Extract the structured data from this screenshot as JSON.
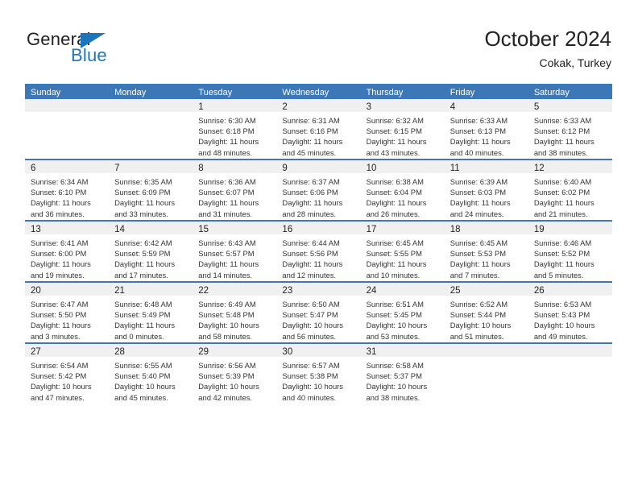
{
  "logo": {
    "word_one": "General",
    "word_two": "Blue",
    "accent_color": "#1b75bb"
  },
  "header": {
    "title": "October 2024",
    "subtitle": "Cokak, Turkey"
  },
  "theme": {
    "header_blue": "#3c77b8",
    "daynum_band": "#f0f0f0",
    "text": "#333333"
  },
  "weekdays": [
    "Sunday",
    "Monday",
    "Tuesday",
    "Wednesday",
    "Thursday",
    "Friday",
    "Saturday"
  ],
  "weeks": [
    [
      {
        "day": "",
        "sunrise": "",
        "sunset": "",
        "daylight_line1": "",
        "daylight_line2": ""
      },
      {
        "day": "",
        "sunrise": "",
        "sunset": "",
        "daylight_line1": "",
        "daylight_line2": ""
      },
      {
        "day": "1",
        "sunrise": "Sunrise: 6:30 AM",
        "sunset": "Sunset: 6:18 PM",
        "daylight_line1": "Daylight: 11 hours",
        "daylight_line2": "and 48 minutes."
      },
      {
        "day": "2",
        "sunrise": "Sunrise: 6:31 AM",
        "sunset": "Sunset: 6:16 PM",
        "daylight_line1": "Daylight: 11 hours",
        "daylight_line2": "and 45 minutes."
      },
      {
        "day": "3",
        "sunrise": "Sunrise: 6:32 AM",
        "sunset": "Sunset: 6:15 PM",
        "daylight_line1": "Daylight: 11 hours",
        "daylight_line2": "and 43 minutes."
      },
      {
        "day": "4",
        "sunrise": "Sunrise: 6:33 AM",
        "sunset": "Sunset: 6:13 PM",
        "daylight_line1": "Daylight: 11 hours",
        "daylight_line2": "and 40 minutes."
      },
      {
        "day": "5",
        "sunrise": "Sunrise: 6:33 AM",
        "sunset": "Sunset: 6:12 PM",
        "daylight_line1": "Daylight: 11 hours",
        "daylight_line2": "and 38 minutes."
      }
    ],
    [
      {
        "day": "6",
        "sunrise": "Sunrise: 6:34 AM",
        "sunset": "Sunset: 6:10 PM",
        "daylight_line1": "Daylight: 11 hours",
        "daylight_line2": "and 36 minutes."
      },
      {
        "day": "7",
        "sunrise": "Sunrise: 6:35 AM",
        "sunset": "Sunset: 6:09 PM",
        "daylight_line1": "Daylight: 11 hours",
        "daylight_line2": "and 33 minutes."
      },
      {
        "day": "8",
        "sunrise": "Sunrise: 6:36 AM",
        "sunset": "Sunset: 6:07 PM",
        "daylight_line1": "Daylight: 11 hours",
        "daylight_line2": "and 31 minutes."
      },
      {
        "day": "9",
        "sunrise": "Sunrise: 6:37 AM",
        "sunset": "Sunset: 6:06 PM",
        "daylight_line1": "Daylight: 11 hours",
        "daylight_line2": "and 28 minutes."
      },
      {
        "day": "10",
        "sunrise": "Sunrise: 6:38 AM",
        "sunset": "Sunset: 6:04 PM",
        "daylight_line1": "Daylight: 11 hours",
        "daylight_line2": "and 26 minutes."
      },
      {
        "day": "11",
        "sunrise": "Sunrise: 6:39 AM",
        "sunset": "Sunset: 6:03 PM",
        "daylight_line1": "Daylight: 11 hours",
        "daylight_line2": "and 24 minutes."
      },
      {
        "day": "12",
        "sunrise": "Sunrise: 6:40 AM",
        "sunset": "Sunset: 6:02 PM",
        "daylight_line1": "Daylight: 11 hours",
        "daylight_line2": "and 21 minutes."
      }
    ],
    [
      {
        "day": "13",
        "sunrise": "Sunrise: 6:41 AM",
        "sunset": "Sunset: 6:00 PM",
        "daylight_line1": "Daylight: 11 hours",
        "daylight_line2": "and 19 minutes."
      },
      {
        "day": "14",
        "sunrise": "Sunrise: 6:42 AM",
        "sunset": "Sunset: 5:59 PM",
        "daylight_line1": "Daylight: 11 hours",
        "daylight_line2": "and 17 minutes."
      },
      {
        "day": "15",
        "sunrise": "Sunrise: 6:43 AM",
        "sunset": "Sunset: 5:57 PM",
        "daylight_line1": "Daylight: 11 hours",
        "daylight_line2": "and 14 minutes."
      },
      {
        "day": "16",
        "sunrise": "Sunrise: 6:44 AM",
        "sunset": "Sunset: 5:56 PM",
        "daylight_line1": "Daylight: 11 hours",
        "daylight_line2": "and 12 minutes."
      },
      {
        "day": "17",
        "sunrise": "Sunrise: 6:45 AM",
        "sunset": "Sunset: 5:55 PM",
        "daylight_line1": "Daylight: 11 hours",
        "daylight_line2": "and 10 minutes."
      },
      {
        "day": "18",
        "sunrise": "Sunrise: 6:45 AM",
        "sunset": "Sunset: 5:53 PM",
        "daylight_line1": "Daylight: 11 hours",
        "daylight_line2": "and 7 minutes."
      },
      {
        "day": "19",
        "sunrise": "Sunrise: 6:46 AM",
        "sunset": "Sunset: 5:52 PM",
        "daylight_line1": "Daylight: 11 hours",
        "daylight_line2": "and 5 minutes."
      }
    ],
    [
      {
        "day": "20",
        "sunrise": "Sunrise: 6:47 AM",
        "sunset": "Sunset: 5:50 PM",
        "daylight_line1": "Daylight: 11 hours",
        "daylight_line2": "and 3 minutes."
      },
      {
        "day": "21",
        "sunrise": "Sunrise: 6:48 AM",
        "sunset": "Sunset: 5:49 PM",
        "daylight_line1": "Daylight: 11 hours",
        "daylight_line2": "and 0 minutes."
      },
      {
        "day": "22",
        "sunrise": "Sunrise: 6:49 AM",
        "sunset": "Sunset: 5:48 PM",
        "daylight_line1": "Daylight: 10 hours",
        "daylight_line2": "and 58 minutes."
      },
      {
        "day": "23",
        "sunrise": "Sunrise: 6:50 AM",
        "sunset": "Sunset: 5:47 PM",
        "daylight_line1": "Daylight: 10 hours",
        "daylight_line2": "and 56 minutes."
      },
      {
        "day": "24",
        "sunrise": "Sunrise: 6:51 AM",
        "sunset": "Sunset: 5:45 PM",
        "daylight_line1": "Daylight: 10 hours",
        "daylight_line2": "and 53 minutes."
      },
      {
        "day": "25",
        "sunrise": "Sunrise: 6:52 AM",
        "sunset": "Sunset: 5:44 PM",
        "daylight_line1": "Daylight: 10 hours",
        "daylight_line2": "and 51 minutes."
      },
      {
        "day": "26",
        "sunrise": "Sunrise: 6:53 AM",
        "sunset": "Sunset: 5:43 PM",
        "daylight_line1": "Daylight: 10 hours",
        "daylight_line2": "and 49 minutes."
      }
    ],
    [
      {
        "day": "27",
        "sunrise": "Sunrise: 6:54 AM",
        "sunset": "Sunset: 5:42 PM",
        "daylight_line1": "Daylight: 10 hours",
        "daylight_line2": "and 47 minutes."
      },
      {
        "day": "28",
        "sunrise": "Sunrise: 6:55 AM",
        "sunset": "Sunset: 5:40 PM",
        "daylight_line1": "Daylight: 10 hours",
        "daylight_line2": "and 45 minutes."
      },
      {
        "day": "29",
        "sunrise": "Sunrise: 6:56 AM",
        "sunset": "Sunset: 5:39 PM",
        "daylight_line1": "Daylight: 10 hours",
        "daylight_line2": "and 42 minutes."
      },
      {
        "day": "30",
        "sunrise": "Sunrise: 6:57 AM",
        "sunset": "Sunset: 5:38 PM",
        "daylight_line1": "Daylight: 10 hours",
        "daylight_line2": "and 40 minutes."
      },
      {
        "day": "31",
        "sunrise": "Sunrise: 6:58 AM",
        "sunset": "Sunset: 5:37 PM",
        "daylight_line1": "Daylight: 10 hours",
        "daylight_line2": "and 38 minutes."
      },
      {
        "day": "",
        "sunrise": "",
        "sunset": "",
        "daylight_line1": "",
        "daylight_line2": ""
      },
      {
        "day": "",
        "sunrise": "",
        "sunset": "",
        "daylight_line1": "",
        "daylight_line2": ""
      }
    ]
  ]
}
